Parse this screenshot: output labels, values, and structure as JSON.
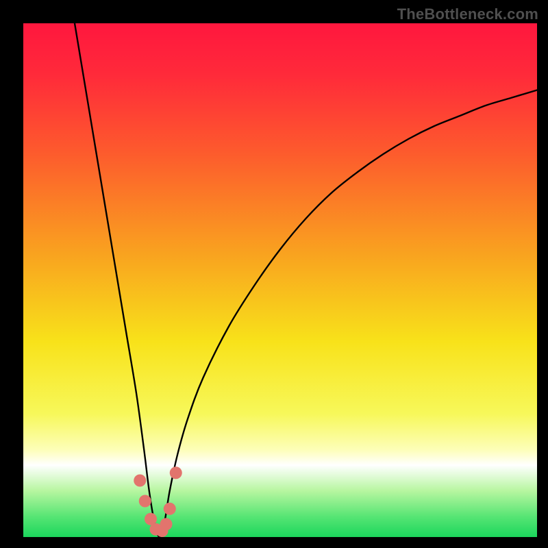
{
  "watermark": "TheBottleneck.com",
  "chart_data": {
    "type": "line",
    "title": "",
    "xlabel": "",
    "ylabel": "",
    "xlim": [
      0,
      100
    ],
    "ylim": [
      0,
      100
    ],
    "gradient_stops": [
      {
        "offset": 0.0,
        "color": "#ff173e"
      },
      {
        "offset": 0.1,
        "color": "#ff2a3a"
      },
      {
        "offset": 0.25,
        "color": "#fd5a2d"
      },
      {
        "offset": 0.45,
        "color": "#f9a31f"
      },
      {
        "offset": 0.62,
        "color": "#f8e21a"
      },
      {
        "offset": 0.76,
        "color": "#f7f85a"
      },
      {
        "offset": 0.83,
        "color": "#fdfeb8"
      },
      {
        "offset": 0.86,
        "color": "#ffffff"
      },
      {
        "offset": 0.91,
        "color": "#b7f6a0"
      },
      {
        "offset": 0.96,
        "color": "#57e574"
      },
      {
        "offset": 1.0,
        "color": "#1bd65c"
      }
    ],
    "series": [
      {
        "name": "bottleneck-curve",
        "x": [
          10,
          12,
          14,
          16,
          18,
          20,
          22,
          23.5,
          24.5,
          25.5,
          26.5,
          27.5,
          28.5,
          30,
          32,
          35,
          40,
          45,
          50,
          55,
          60,
          65,
          70,
          75,
          80,
          85,
          90,
          95,
          100
        ],
        "y": [
          100,
          88,
          76,
          64,
          52,
          40,
          28,
          17,
          9,
          3,
          0,
          3,
          9,
          16,
          23,
          31,
          41,
          49,
          56,
          62,
          67,
          71,
          74.5,
          77.5,
          80,
          82,
          84,
          85.5,
          87
        ],
        "note": "y is distance-from-bottom as percent of plot height; minimum (0) at x≈26.5"
      }
    ],
    "markers": {
      "name": "highlight-dots",
      "color": "#e2746d",
      "points_xy_pct": [
        [
          22.7,
          11.0
        ],
        [
          23.7,
          7.0
        ],
        [
          24.8,
          3.5
        ],
        [
          25.8,
          1.5
        ],
        [
          27.0,
          1.2
        ],
        [
          27.8,
          2.5
        ],
        [
          28.5,
          5.5
        ],
        [
          29.7,
          12.5
        ]
      ],
      "note": "xy as percent of plot area, y measured from bottom"
    }
  }
}
